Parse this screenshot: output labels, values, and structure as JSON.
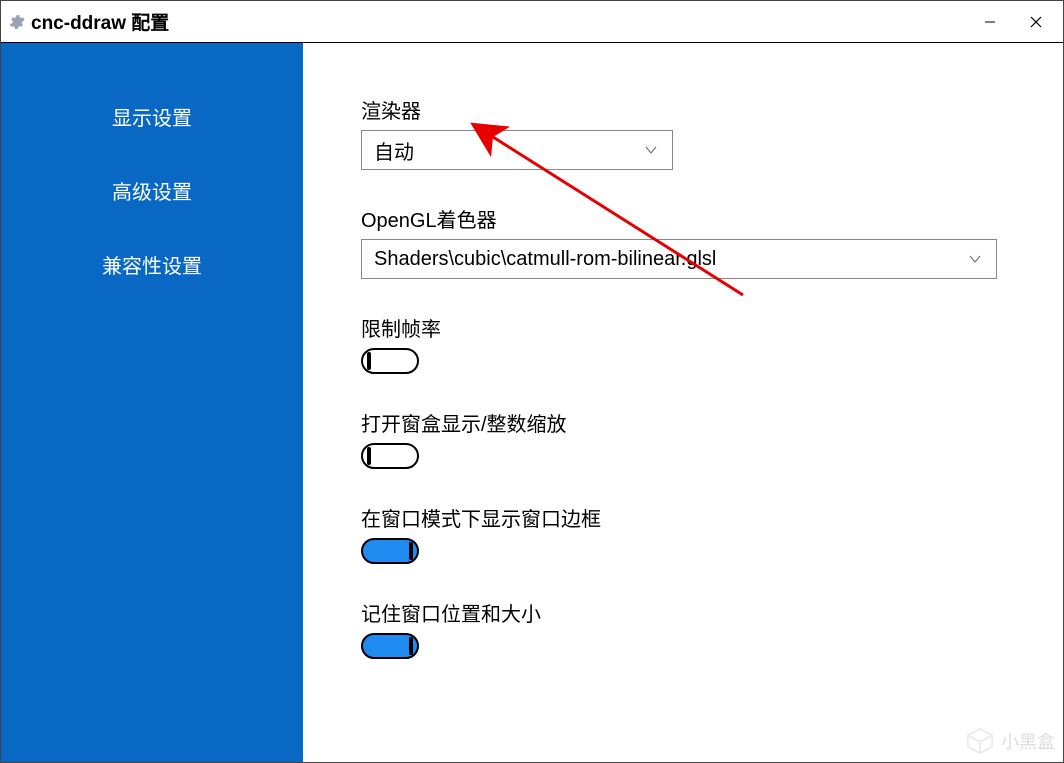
{
  "window": {
    "title": "cnc-ddraw 配置"
  },
  "sidebar": {
    "items": [
      {
        "label": "显示设置"
      },
      {
        "label": "高级设置"
      },
      {
        "label": "兼容性设置"
      }
    ]
  },
  "fields": {
    "renderer": {
      "label": "渲染器",
      "value": "自动"
    },
    "shader": {
      "label": "OpenGL着色器",
      "value": "Shaders\\cubic\\catmull-rom-bilinear.glsl"
    },
    "fps_limit": {
      "label": "限制帧率",
      "on": false
    },
    "boxed": {
      "label": "打开窗盒显示/整数缩放",
      "on": false
    },
    "border": {
      "label": "在窗口模式下显示窗口边框",
      "on": true
    },
    "savepos": {
      "label": "记住窗口位置和大小",
      "on": true
    }
  },
  "watermark": {
    "text": "小黑盒"
  }
}
